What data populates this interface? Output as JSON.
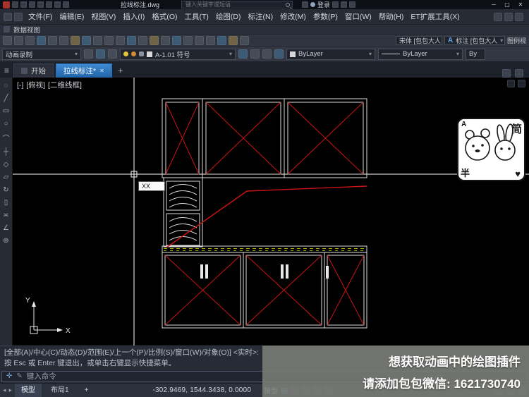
{
  "titlebar": {
    "doc_title": "拉线标注.dwg",
    "search_placeholder": "键入关键字或短语",
    "login": "登录"
  },
  "menubar": {
    "items": [
      "文件(F)",
      "编辑(E)",
      "视图(V)",
      "插入(I)",
      "格式(O)",
      "工具(T)",
      "绘图(D)",
      "标注(N)",
      "修改(M)",
      "参数(P)",
      "窗口(W)",
      "帮助(H)",
      "ET扩展工具(X)"
    ]
  },
  "dataview_label": "数据视图",
  "toolbar_row1": {
    "text_style_combo": "宋体 [包包大人",
    "dim_style_icon": "A",
    "dim_style_combo": "标注 [包包大人",
    "right_label": "图例视"
  },
  "toolbar_row2": {
    "record_combo": "动画录制",
    "layer_combo": "A-1.01 符号",
    "color_combo": "ByLayer",
    "linetype_combo": "ByLayer",
    "lineweight_combo": "By"
  },
  "file_tabs": {
    "start_tab": "开始",
    "active_tab": "拉线标注*",
    "new_tab": "+"
  },
  "viewport": {
    "vp_control": "[-]",
    "view_control": "[俯视]",
    "visual_control": "[二维线框]",
    "dyn_input": "XX",
    "ucs_x": "X",
    "ucs_y": "Y"
  },
  "sticker": {
    "letter": "A",
    "char_left": "半",
    "char_right": "简",
    "heart": "♥"
  },
  "command_line": {
    "history1": "[全部(A)/中心(C)/动态(D)/范围(E)/上一个(P)/比例(S)/窗口(W)/对象(O)] <实时>:",
    "history2": "按 Esc 或 Enter 键退出，或单击右键显示快捷菜单。",
    "input_placeholder": "键入命令"
  },
  "statusbar": {
    "coordinates": "-302.9469, 1544.3438, 0.0000",
    "model_toggle": "模型",
    "layout_tabs": [
      "模型",
      "布局1"
    ],
    "add_layout": "+"
  },
  "overlay_ad": {
    "line1": "想获取动画中的绘图插件",
    "line2": "请添加包包微信: 1621730740"
  },
  "icons": {
    "dropdown": "▾",
    "window_min": "─",
    "window_max": "▢",
    "window_close": "✕",
    "hamburger": "≡",
    "close_tab": "✕",
    "nav_back": "◂",
    "nav_forward": "▸",
    "cmd_prompt": "✛",
    "cmd_pencil": "✎",
    "grid": "▦",
    "palette": [
      "◌",
      "╱",
      "▭",
      "○",
      "⌒",
      "┼",
      "◇",
      "▱",
      "↻",
      "▯",
      "≍",
      "∠",
      "⊕"
    ]
  }
}
